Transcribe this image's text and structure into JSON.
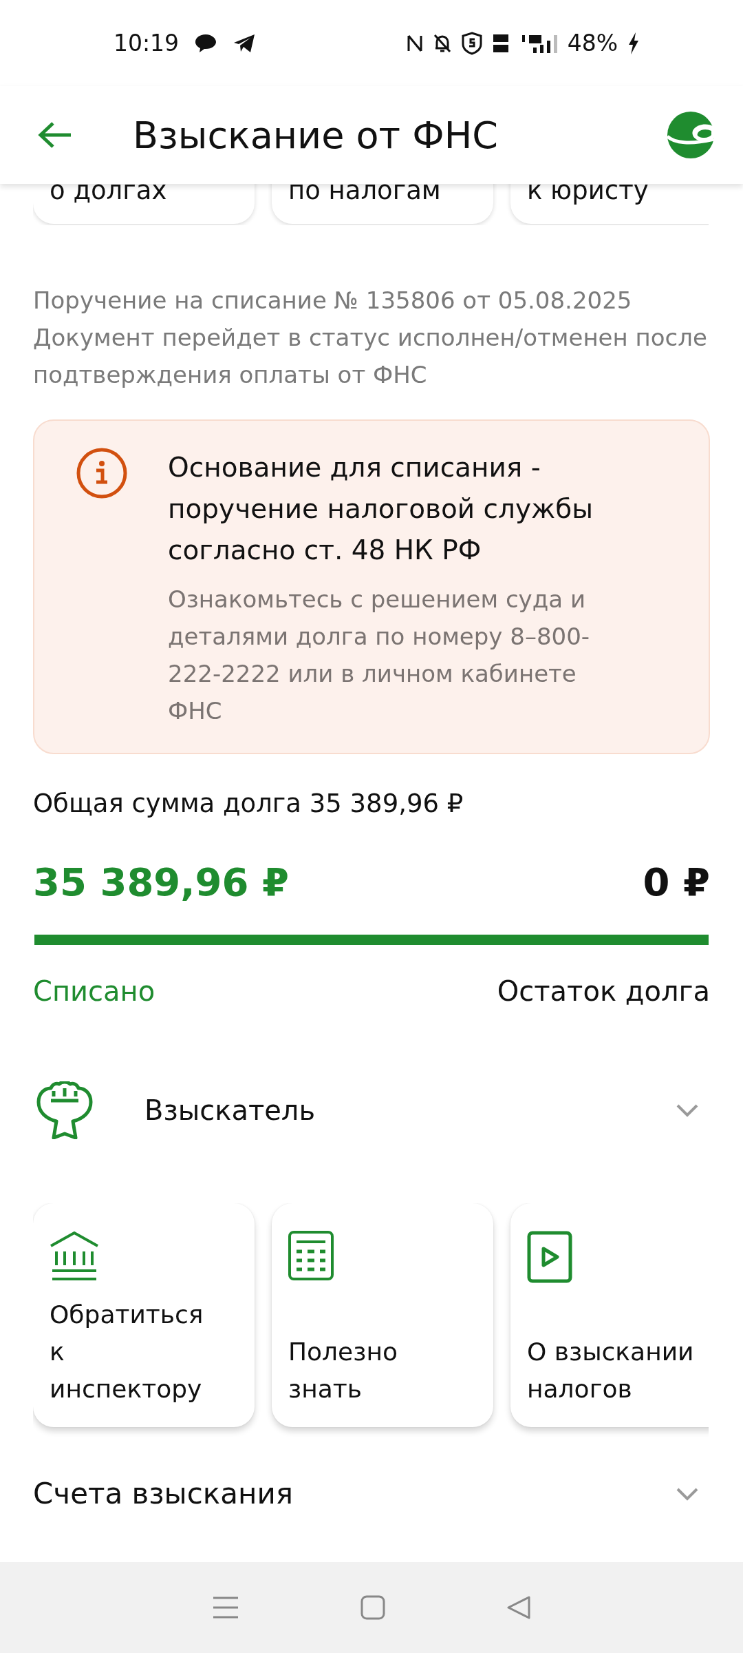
{
  "status_bar": {
    "time": "10:19",
    "battery": "48%"
  },
  "header": {
    "title": "Взыскание от ФНС"
  },
  "top_cards": [
    {
      "label": "о долгах"
    },
    {
      "label": "по налогам"
    },
    {
      "label": "к юристу"
    }
  ],
  "order_note": "Поручение на списание № 135806 от 05.08.2025 Документ перейдет в статус исполнен/отменен после подтверждения оплаты от ФНС",
  "notice": {
    "title": "Основание для списания - поручение налоговой службы согласно ст. 48 НК РФ",
    "text": "Ознакомьтесь с решением суда и деталями долга по номеру 8–800-222-2222 или в личном кабинете ФНС"
  },
  "debt": {
    "total": "Общая сумма долга 35 389,96 ₽",
    "paid_amount": "35 389,96 ₽",
    "remaining_amount": "0 ₽",
    "level": 1,
    "paid_label": "Списано",
    "remaining_label": "Остаток долга"
  },
  "collector": {
    "label": "Взыскатель",
    "expanded": false
  },
  "action_cards": [
    {
      "kind": "bank",
      "label": "Обратиться к инспектору"
    },
    {
      "kind": "calculator",
      "label": "Полезно знать"
    },
    {
      "kind": "video",
      "label": "О взыскании налогов"
    }
  ],
  "accounts": {
    "label": "Счета взыскания",
    "expanded": false
  }
}
